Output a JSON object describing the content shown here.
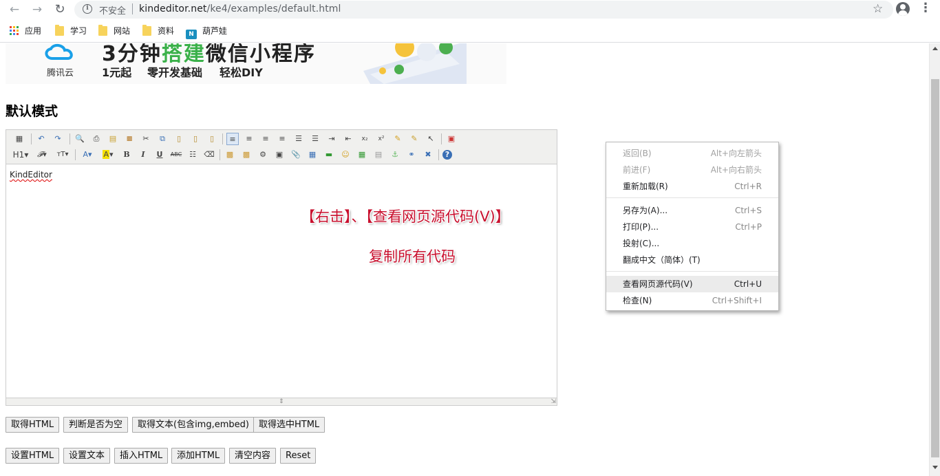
{
  "browser": {
    "insecure_label": "不安全",
    "url_host": "kindeditor.net",
    "url_path": "/ke4/examples/default.html",
    "bookmarks": [
      "应用",
      "学习",
      "网站",
      "资料",
      "葫芦娃"
    ]
  },
  "banner": {
    "brand": "腾讯云",
    "title_a": "3分钟",
    "title_b": "搭建",
    "title_c": "微信小程序",
    "sub1": "1元起",
    "sub2": "零开发基础",
    "sub3": "轻松DIY"
  },
  "page": {
    "heading": "默认模式"
  },
  "editor": {
    "content": "KindEditor",
    "toolbar_row2_labels": [
      "H1",
      "A",
      "B",
      "I",
      "U"
    ]
  },
  "overlay": {
    "line1": "【右击】、【查看网页源代码(V)】",
    "line2": "复制所有代码"
  },
  "buttons_row1": [
    "取得HTML",
    "判断是否为空",
    "取得文本(包含img,embed)",
    "取得选中HTML"
  ],
  "buttons_row2": [
    "设置HTML",
    "设置文本",
    "插入HTML",
    "添加HTML",
    "清空内容",
    "Reset"
  ],
  "context_menu": {
    "items": [
      {
        "label": "返回(B)",
        "key": "Alt+向左箭头"
      },
      {
        "label": "前进(F)",
        "key": "Alt+向右箭头"
      },
      {
        "label": "重新加载(R)",
        "key": "Ctrl+R"
      },
      {
        "label": "另存为(A)...",
        "key": "Ctrl+S"
      },
      {
        "label": "打印(P)...",
        "key": "Ctrl+P"
      },
      {
        "label": "投射(C)...",
        "key": ""
      },
      {
        "label": "翻成中文（简体）(T)",
        "key": ""
      },
      {
        "label": "查看网页源代码(V)",
        "key": "Ctrl+U"
      },
      {
        "label": "检查(N)",
        "key": "Ctrl+Shift+I"
      }
    ]
  },
  "colors": {
    "accent_green": "#3bb14a",
    "overlay_red": "#c8102e",
    "toolbar_bg": "#f0f0ee"
  }
}
